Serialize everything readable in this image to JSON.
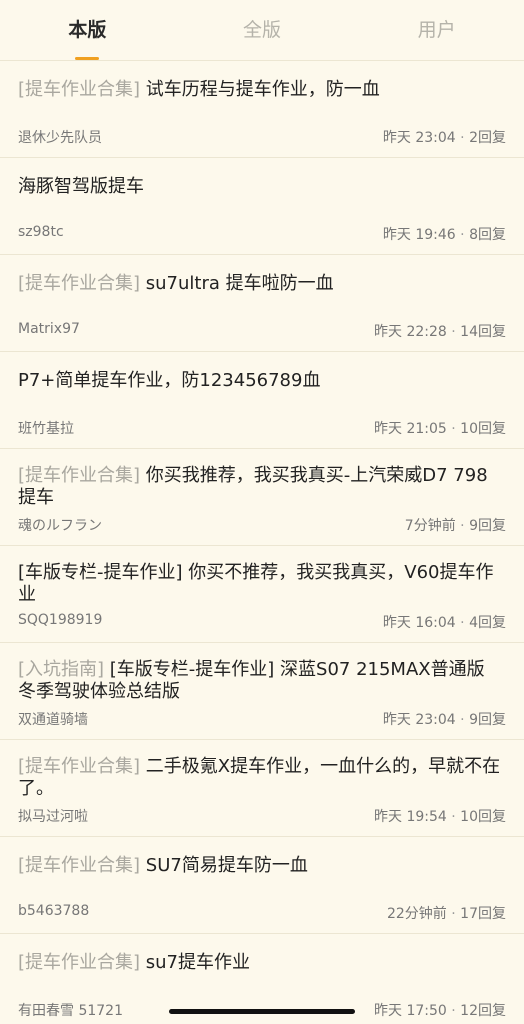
{
  "tabs": [
    {
      "label": "本版",
      "active": true
    },
    {
      "label": "全版",
      "active": false
    },
    {
      "label": "用户",
      "active": false
    }
  ],
  "threads": [
    {
      "tag": "[提车作业合集]",
      "title": " 试车历程与提车作业，防一血",
      "author": "退休少先队员",
      "time": "昨天 23:04",
      "dot": " · ",
      "replies": "2回复"
    },
    {
      "tag": "",
      "title": "海豚智驾版提车",
      "author": "sz98tc",
      "time": "昨天 19:46",
      "dot": " · ",
      "replies": "8回复"
    },
    {
      "tag": "[提车作业合集]",
      "title": " su7ultra 提车啦防一血",
      "author": "Matrix97",
      "time": "昨天 22:28",
      "dot": " · ",
      "replies": "14回复"
    },
    {
      "tag": "",
      "title": "P7+简单提车作业，防123456789血",
      "author": "班竹基拉",
      "time": "昨天 21:05",
      "dot": " · ",
      "replies": "10回复"
    },
    {
      "tag": "[提车作业合集]",
      "title": " 你买我推荐，我买我真买-上汽荣威D7  798提车",
      "author": "魂のルフラン",
      "time": "7分钟前",
      "dot": " · ",
      "replies": "9回复"
    },
    {
      "tag": "",
      "title": "[车版专栏-提车作业] 你买不推荐，我买我真买，V60提车作业",
      "author": "SQQ198919",
      "time": "昨天 16:04",
      "dot": " · ",
      "replies": "4回复"
    },
    {
      "tag": "[入坑指南]",
      "title": " [车版专栏-提车作业] 深蓝S07 215MAX普通版冬季驾驶体验总结版",
      "author": "双通道骑墙",
      "time": "昨天 23:04",
      "dot": " · ",
      "replies": "9回复"
    },
    {
      "tag": "[提车作业合集]",
      "title": " 二手极氪X提车作业，一血什么的，早就不在了。",
      "author": "拟马过河啦",
      "time": "昨天 19:54",
      "dot": " · ",
      "replies": "10回复"
    },
    {
      "tag": "[提车作业合集]",
      "title": " SU7简易提车防一血",
      "author": "b5463788",
      "time": "22分钟前",
      "dot": " · ",
      "replies": "17回复"
    },
    {
      "tag": "[提车作业合集]",
      "title": " su7提车作业",
      "author": "有田春雪 51721",
      "time": "昨天 17:50",
      "dot": " · ",
      "replies": "12回复"
    }
  ]
}
